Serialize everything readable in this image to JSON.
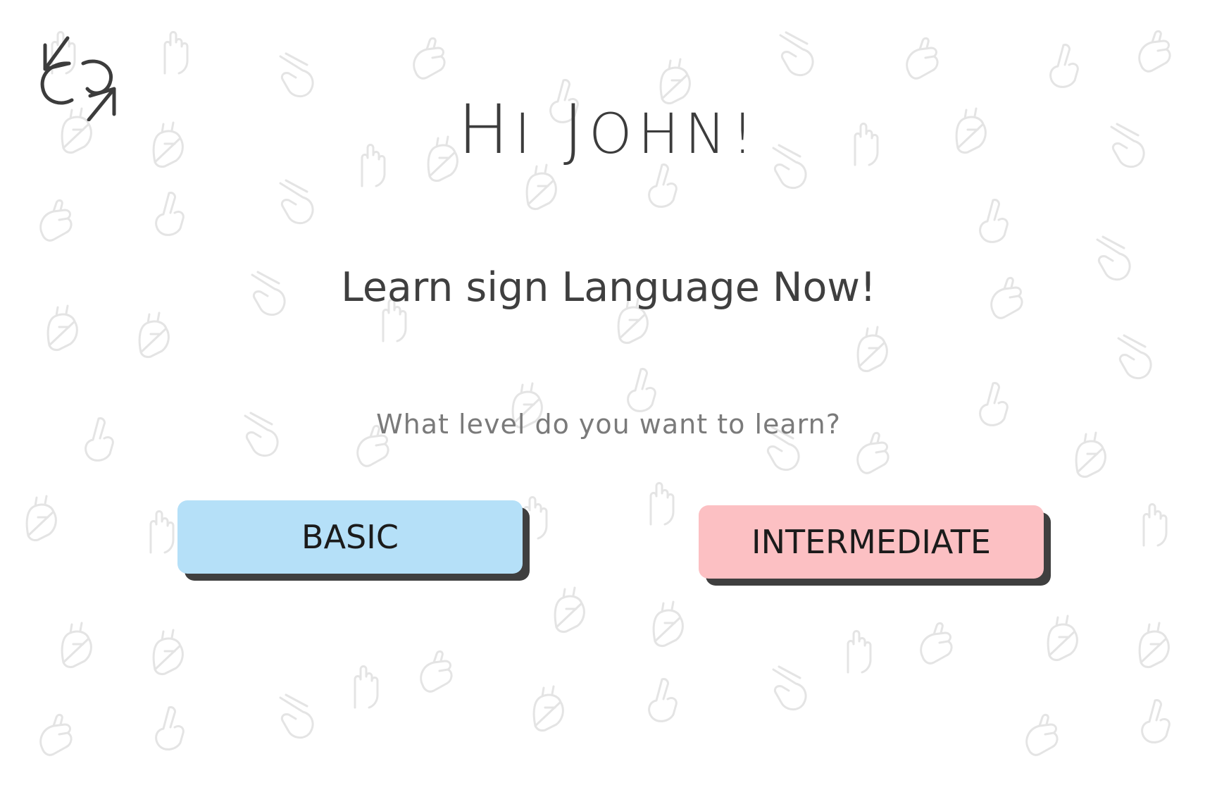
{
  "greeting": {
    "first": "H",
    "first_rest": "I",
    "name_first": "J",
    "name_rest": "OHN!"
  },
  "headline": "Learn sign Language Now!",
  "question": "What level do you want to learn?",
  "levels": [
    {
      "label": "BASIC",
      "color": "#b5e0f8"
    },
    {
      "label": "INTERMEDIATE",
      "color": "#fcc0c3"
    }
  ],
  "colors": {
    "text": "#3f3f3f",
    "muted": "#7a7a7a",
    "shadow": "#3f3f3f",
    "pattern": "#e6e6e6"
  },
  "icons": {
    "logo": "sign-language-logo-icon",
    "background": "hand-sign-pattern-icon"
  }
}
